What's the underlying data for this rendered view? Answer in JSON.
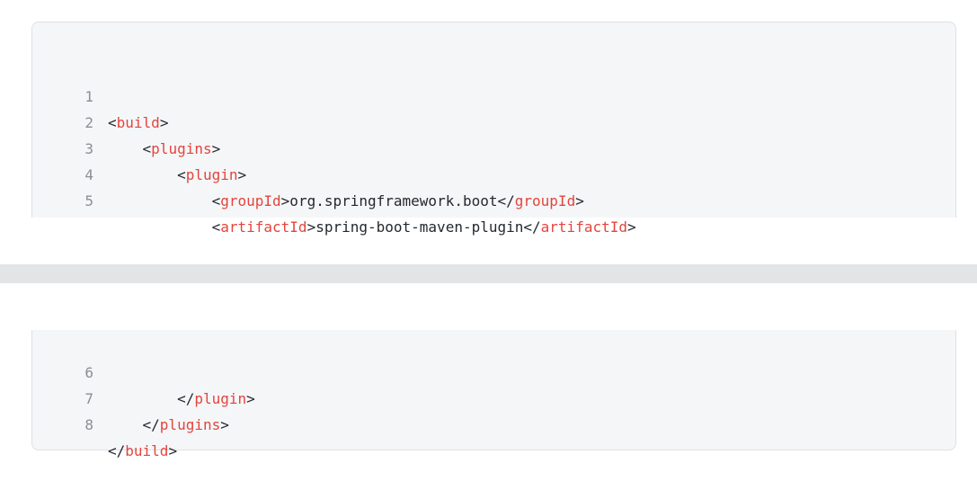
{
  "code": {
    "lines": [
      {
        "n": "1",
        "parts": [
          {
            "t": "<",
            "k": "punct"
          },
          {
            "t": "build",
            "k": "tag"
          },
          {
            "t": ">",
            "k": "punct"
          }
        ]
      },
      {
        "n": "2",
        "parts": [
          {
            "t": "    <",
            "k": "punct"
          },
          {
            "t": "plugins",
            "k": "tag"
          },
          {
            "t": ">",
            "k": "punct"
          }
        ]
      },
      {
        "n": "3",
        "parts": [
          {
            "t": "        <",
            "k": "punct"
          },
          {
            "t": "plugin",
            "k": "tag"
          },
          {
            "t": ">",
            "k": "punct"
          }
        ]
      },
      {
        "n": "4",
        "parts": [
          {
            "t": "            <",
            "k": "punct"
          },
          {
            "t": "groupId",
            "k": "tag"
          },
          {
            "t": ">org.springframework.boot</",
            "k": "punct"
          },
          {
            "t": "groupId",
            "k": "tag"
          },
          {
            "t": ">",
            "k": "punct"
          }
        ]
      },
      {
        "n": "5",
        "parts": [
          {
            "t": "            <",
            "k": "punct"
          },
          {
            "t": "artifactId",
            "k": "tag"
          },
          {
            "t": ">spring-boot-maven-plugin</",
            "k": "punct"
          },
          {
            "t": "artifactId",
            "k": "tag"
          },
          {
            "t": ">",
            "k": "punct"
          }
        ]
      },
      {
        "n": "6",
        "parts": [
          {
            "t": "        </",
            "k": "punct"
          },
          {
            "t": "plugin",
            "k": "tag"
          },
          {
            "t": ">",
            "k": "punct"
          }
        ]
      },
      {
        "n": "7",
        "parts": [
          {
            "t": "    </",
            "k": "punct"
          },
          {
            "t": "plugins",
            "k": "tag"
          },
          {
            "t": ">",
            "k": "punct"
          }
        ]
      },
      {
        "n": "8",
        "parts": [
          {
            "t": "</",
            "k": "punct"
          },
          {
            "t": "build",
            "k": "tag"
          },
          {
            "t": ">",
            "k": "punct"
          }
        ]
      }
    ]
  },
  "colors": {
    "tag": "#e4443d",
    "text": "#24292e",
    "line_number": "#8a8f96",
    "background": "#f5f6f8"
  }
}
